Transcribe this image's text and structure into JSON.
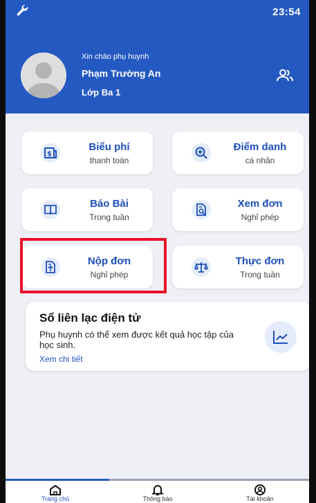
{
  "status_bar": {
    "time": "23:54",
    "icon": "wrench-icon"
  },
  "header": {
    "greeting": "Xin chào phụ huynh",
    "student_name": "Phạm Trường An",
    "class_name": "Lớp Ba 1",
    "switch_icon": "people-icon"
  },
  "menu": [
    {
      "title": "Biểu phí",
      "subtitle": "thanh toán",
      "icon": "fee-icon"
    },
    {
      "title": "Điểm danh",
      "subtitle": "cá nhân",
      "icon": "zoom-plus-icon"
    },
    {
      "title": "Báo Bài",
      "subtitle": "Trong tuần",
      "icon": "book-icon"
    },
    {
      "title": "Xem đơn",
      "subtitle": "Nghỉ phép",
      "icon": "document-search-icon"
    },
    {
      "title": "Nộp đơn",
      "subtitle": "Nghỉ phép",
      "icon": "document-upload-icon"
    },
    {
      "title": "Thực đơn",
      "subtitle": "Trong tuần",
      "icon": "scale-icon"
    }
  ],
  "journal": {
    "title": "Sổ liên lạc điện tử",
    "description": "Phụ huynh có thể xem được kết quả học tập của học sinh.",
    "link": "Xem chi tiết",
    "icon": "line-chart-icon"
  },
  "bottom_nav": [
    {
      "label": "Trang chủ",
      "icon": "home-icon",
      "active": true
    },
    {
      "label": "Thông báo",
      "icon": "bell-icon",
      "active": false
    },
    {
      "label": "Tài khoản",
      "icon": "account-icon",
      "active": false
    }
  ],
  "colors": {
    "primary": "#2459c2",
    "highlight": "#e8102a",
    "background": "#eef0f5"
  }
}
